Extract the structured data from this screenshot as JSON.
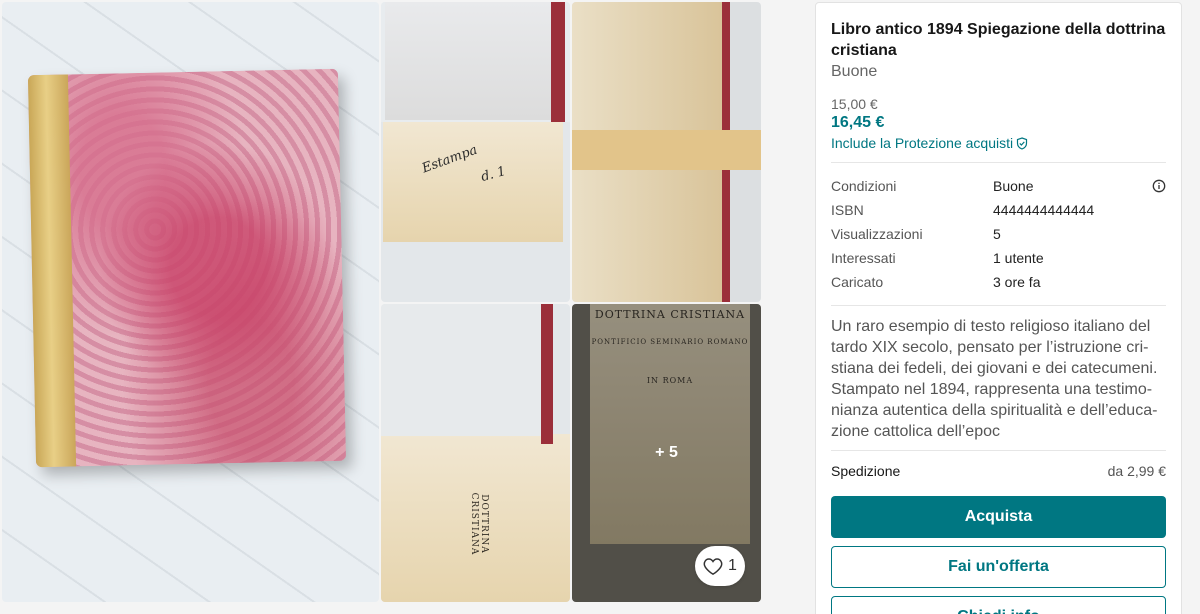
{
  "gallery": {
    "more_label": "+ 5",
    "favorites_count": "1",
    "page_print": {
      "title1": "DOTTRINA CRISTIANA",
      "title2": "PONTIFICIO SEMINARIO ROMANO",
      "title3": "IN ROMA"
    }
  },
  "item": {
    "title": "Libro antico 1894 Spiegazione della dottrina cristiana",
    "condition": "Buone",
    "price": "15,00 €",
    "price_with_protection": "16,45 €",
    "protection_link": "Include la Protezione acquisti"
  },
  "details": [
    {
      "label": "Condizioni",
      "value": "Buone"
    },
    {
      "label": "ISBN",
      "value": "4444444444444"
    },
    {
      "label": "Visualizzazioni",
      "value": "5"
    },
    {
      "label": "Interessati",
      "value": "1 utente"
    },
    {
      "label": "Caricato",
      "value": "3 ore fa"
    }
  ],
  "description": "Un raro esempio di testo religioso italiano del tardo XIX secolo, pensato per l’istruzione cri-stiana dei fedeli, dei giovani e dei catecumeni. Stampato nel 1894, rappresenta una testimo-nianza autentica della spiritualità e dell’educa-zione cattolica dell’epoc",
  "shipping": {
    "label": "Spedizione",
    "value": "da 2,99 €"
  },
  "actions": {
    "buy": "Acquista",
    "offer": "Fai un'offerta",
    "ask": "Chiedi info"
  },
  "colors": {
    "accent": "#007782"
  }
}
